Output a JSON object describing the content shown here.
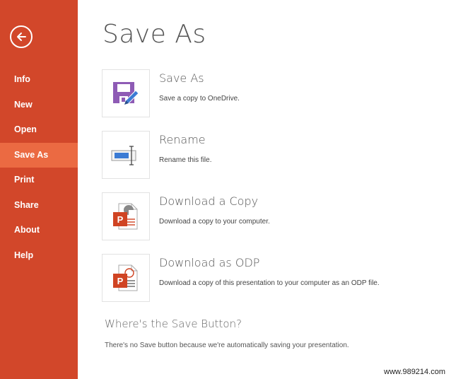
{
  "sidebar": {
    "back_label": "Back",
    "items": [
      {
        "label": "Info",
        "active": false
      },
      {
        "label": "New",
        "active": false
      },
      {
        "label": "Open",
        "active": false
      },
      {
        "label": "Save As",
        "active": true
      },
      {
        "label": "Print",
        "active": false
      },
      {
        "label": "Share",
        "active": false
      },
      {
        "label": "About",
        "active": false
      },
      {
        "label": "Help",
        "active": false
      }
    ]
  },
  "main": {
    "title": "Save As",
    "options": [
      {
        "title": "Save As",
        "description": "Save a copy to OneDrive.",
        "icon": "floppy-pencil-icon"
      },
      {
        "title": "Rename",
        "description": "Rename this file.",
        "icon": "rename-textbox-icon"
      },
      {
        "title": "Download a Copy",
        "description": "Download a copy to your computer.",
        "icon": "powerpoint-file-icon"
      },
      {
        "title": "Download as ODP",
        "description": "Download a copy of this presentation to your computer as an ODP file.",
        "icon": "powerpoint-odp-file-icon"
      }
    ],
    "help": {
      "title": "Where's the Save Button?",
      "text": "There's no Save button because we're automatically saving your presentation."
    }
  },
  "watermark": "www.989214.com",
  "colors": {
    "sidebar": "#D2472A",
    "sidebar_active": "#EB6A42",
    "save_icon": "#8E5BB5",
    "pencil": "#3B7BD4",
    "powerpoint": "#D04423"
  }
}
